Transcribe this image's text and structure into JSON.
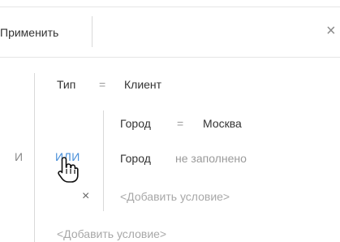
{
  "toolbar": {
    "apply_label": "Применить",
    "close_glyph": "×"
  },
  "group": {
    "and_label": "И",
    "or_label": "ИЛИ",
    "remove_glyph": "×",
    "add_condition": "<Добавить условие>"
  },
  "conditions": [
    {
      "field": "Тип",
      "operator": "=",
      "value": "Клиент"
    }
  ],
  "or_group": {
    "conditions": [
      {
        "field": "Город",
        "operator": "=",
        "value": "Москва"
      },
      {
        "field": "Город",
        "operator": "не заполнено",
        "value": ""
      }
    ],
    "add_condition": "<Добавить условие>"
  },
  "icons": {
    "cursor": "hand-pointer-icon"
  },
  "colors": {
    "link": "#4a90d9",
    "muted": "#9a9a9a",
    "divider": "#e6e6e6"
  }
}
